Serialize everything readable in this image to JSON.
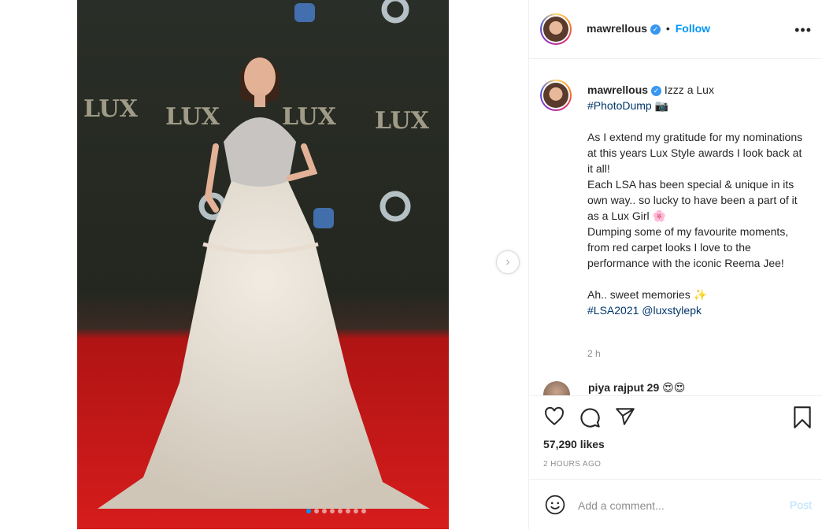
{
  "post": {
    "username": "mawrellous",
    "follow_label": "Follow",
    "separator": "•",
    "more_glyph": "•••",
    "carousel_next_glyph": "›",
    "carousel": {
      "count": 8,
      "active_index": 0
    }
  },
  "caption": {
    "username": "mawrellous",
    "line1": "Izzz a Lux",
    "hashtag_photodump": "#PhotoDump",
    "camera_emoji": "📷",
    "para1": "As I extend my gratitude for my nominations at this years Lux Style awards I look back at it all!",
    "para2": "Each LSA has been special & unique in its own way.. so lucky to have been a part of it as a Lux Girl",
    "flower_emoji": "🌸",
    "para3": "Dumping some of my favourite moments, from red carpet looks I love to the performance with the iconic Reema Jee!",
    "para4": "Ah.. sweet memories",
    "sparkle_emoji": "✨",
    "hashtag_lsa": "#LSA2021",
    "mention": "@luxstylepk",
    "time_relative": "2 h"
  },
  "comment_preview": {
    "username": "piya rajput 29",
    "emojis": "😍😍"
  },
  "actions": {
    "icons": [
      "heart-icon",
      "comment-icon",
      "share-icon",
      "bookmark-icon"
    ],
    "likes": "57,290 likes",
    "timestamp": "2 HOURS AGO"
  },
  "add_comment": {
    "placeholder": "Add a comment...",
    "post_label": "Post",
    "emoji_icon": "smiley-icon"
  },
  "colors": {
    "link": "#0095f6",
    "hashtag": "#00376b",
    "verified": "#3897f0",
    "post_disabled": "#b2dffc"
  }
}
